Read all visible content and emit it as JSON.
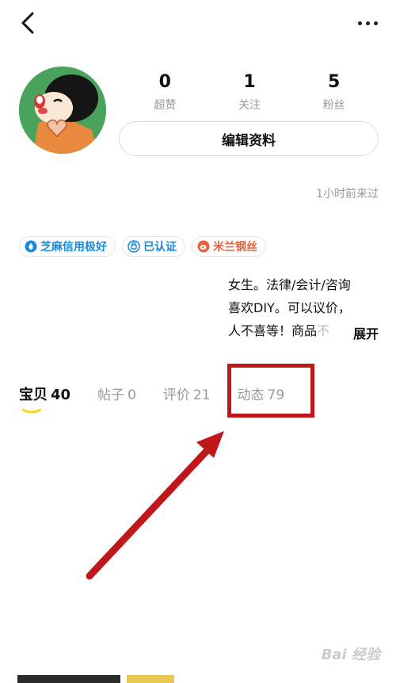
{
  "header": {
    "back_icon": "chevron-left-icon",
    "more_icon": "more-dots-icon"
  },
  "profile": {
    "avatar_icon": "cartoon-avatar",
    "stats": [
      {
        "value": "0",
        "label": "超赞"
      },
      {
        "value": "1",
        "label": "关注"
      },
      {
        "value": "5",
        "label": "粉丝"
      }
    ],
    "edit_label": "编辑资料",
    "last_seen": "1小时前来过"
  },
  "badges": [
    {
      "label": "芝麻信用极好",
      "icon": "zhima-icon",
      "color": "#1a8ad8"
    },
    {
      "label": "已认证",
      "icon": "verified-icon",
      "color": "#1a8ad8"
    },
    {
      "label": "米兰钢丝",
      "icon": "weibo-icon",
      "color": "#e6623a"
    }
  ],
  "bio": {
    "line1": "女生。法律/会计/咨询",
    "line2": "喜欢DIY。可以议价，",
    "line3": "人不喜等！商品",
    "line3_fade": "不",
    "expand_label": "展开"
  },
  "tabs": [
    {
      "label": "宝贝",
      "count": "40",
      "active": true
    },
    {
      "label": "帖子",
      "count": "0",
      "active": false
    },
    {
      "label": "评价",
      "count": "21",
      "active": false
    },
    {
      "label": "动态",
      "count": "79",
      "active": false
    }
  ],
  "annotation": {
    "box_color": "#c0171b",
    "arrow_color": "#c0171b"
  },
  "watermark": "Bai 经验"
}
